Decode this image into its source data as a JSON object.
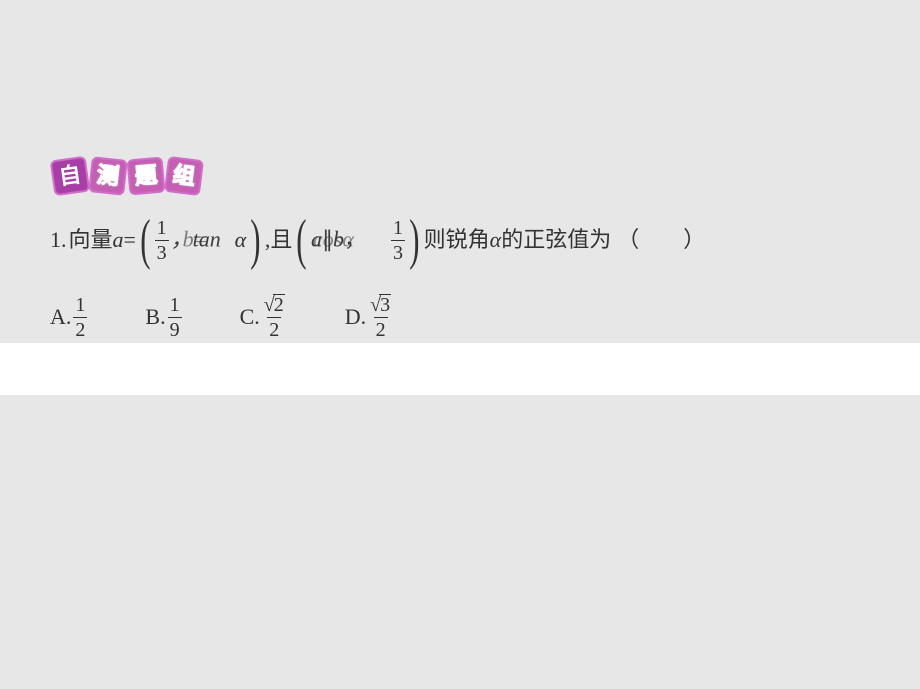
{
  "title_chars": {
    "c1": "自",
    "c2": "测",
    "c3": "题",
    "c4": "组"
  },
  "question": {
    "number": "1.",
    "prefix": "向量",
    "var_a": "a",
    "eq": "=",
    "group1": {
      "frac": {
        "num": "1",
        "den": "3"
      },
      "mid": "，tan",
      "alpha": "α",
      "overlay_b": "b="
    },
    "between": ",且",
    "group2": {
      "mid1": "a",
      "par": "∥",
      "b": "b",
      "cos": "cos",
      "alpha": "α",
      "comma": "，",
      "frac": {
        "num": "1",
        "den": "3"
      }
    },
    "tail1": "则锐角",
    "alpha2": "α",
    "tail2": "的正弦值为",
    "paren_blank": "（　　）"
  },
  "options": {
    "A": {
      "label": "A.",
      "num": "1",
      "den": "2"
    },
    "B": {
      "label": "B.",
      "num": "1",
      "den": "9"
    },
    "C": {
      "label": "C.",
      "sqrt": "2",
      "den": "2"
    },
    "D": {
      "label": "D.",
      "sqrt": "3",
      "den": "2"
    }
  }
}
